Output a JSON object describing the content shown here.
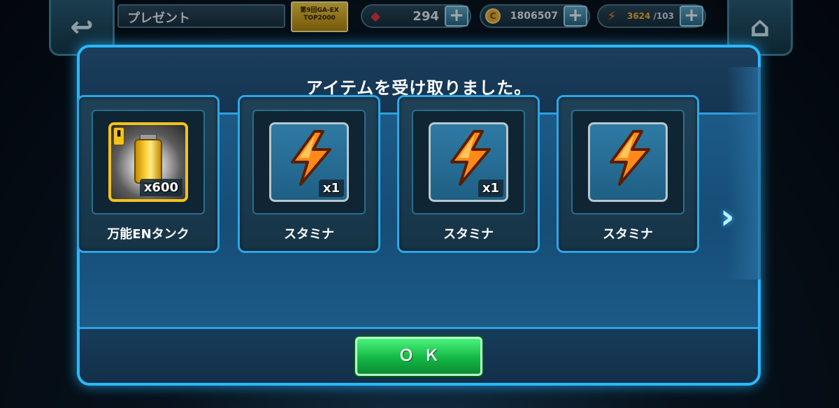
{
  "header": {
    "title": "プレゼント",
    "rank_badge": "第9回GA-EX TOP2000"
  },
  "resources": {
    "gems": "294",
    "coins": "1806507",
    "stamina_current": "3624",
    "stamina_max": "/103"
  },
  "icons": {
    "back": "back-arrow-icon",
    "home": "home-icon",
    "gem": "gem-icon",
    "coin": "coin-icon",
    "stamina": "lightning-icon",
    "add": "plus-icon",
    "next": "chevron-right-icon"
  },
  "modal": {
    "title": "アイテムを受け取りました。",
    "ok_label": "ＯＫ",
    "items": [
      {
        "name": "万能ENタンク",
        "quantity": "x600",
        "icon": "energy-tank-icon"
      },
      {
        "name": "スタミナ",
        "quantity": "x1",
        "icon": "lightning-icon"
      },
      {
        "name": "スタミナ",
        "quantity": "x1",
        "icon": "lightning-icon"
      },
      {
        "name": "スタミナ",
        "quantity": "",
        "icon": "lightning-icon"
      }
    ]
  },
  "colors": {
    "modal_border": "#2bb8ff",
    "ok_button": "#13b845",
    "tank_frame": "#f4c21a",
    "bolt": "#ff8a1a"
  }
}
